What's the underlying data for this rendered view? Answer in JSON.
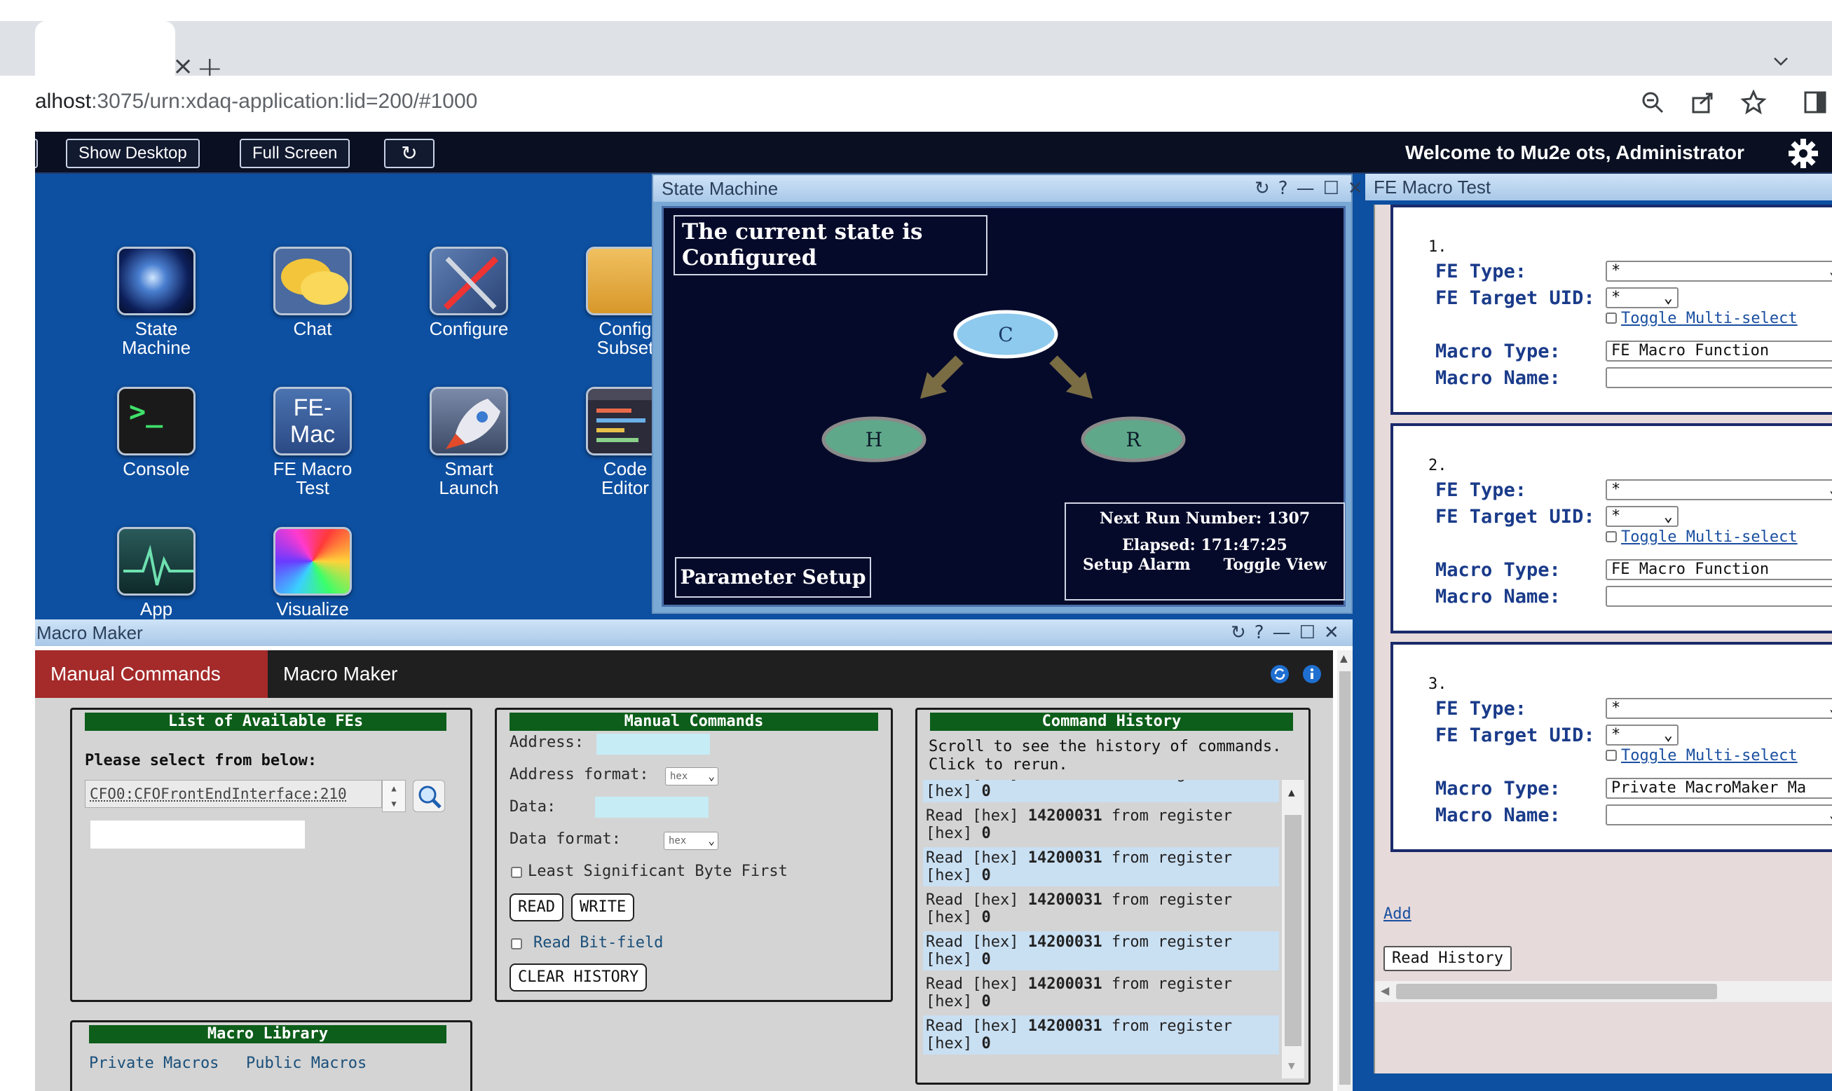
{
  "browser": {
    "tab_close": "×",
    "new_tab": "+",
    "url_host": "alhost",
    "url_rest": ":3075/urn:xdaq-application:lid=200/#1000"
  },
  "topbar": {
    "show_desktop": "Show Desktop",
    "full_screen": "Full Screen",
    "refresh": "↻",
    "welcome": "Welcome to Mu2e ots, Administrator"
  },
  "desktop_icons": [
    {
      "label": "State\nMachine",
      "icon": "galaxy-icon"
    },
    {
      "label": "Chat",
      "icon": "chat-bubbles-icon"
    },
    {
      "label": "Configure",
      "icon": "tools-icon"
    },
    {
      "label": "Config\nSubset",
      "icon": "folder-icon"
    },
    {
      "label": "Console",
      "icon": "terminal-icon",
      "glyph": ">_"
    },
    {
      "label": "FE Macro\nTest",
      "icon": "fe-mac-icon",
      "glyph": "FE-\nMac"
    },
    {
      "label": "Smart\nLaunch",
      "icon": "rocket-icon"
    },
    {
      "label": "Code\nEditor",
      "icon": "code-editor-icon"
    },
    {
      "label": "App",
      "icon": "pulse-icon"
    },
    {
      "label": "Visualize",
      "icon": "prism-icon"
    }
  ],
  "state_machine": {
    "title": "State Machine",
    "current_state": "The current state is Configured",
    "nodes": {
      "center": "C",
      "left": "H",
      "right": "R"
    },
    "parameter_setup": "Parameter Setup",
    "next_run": "Next Run Number: 1307",
    "elapsed": "Elapsed: 171:47:25",
    "setup_alarm": "Setup Alarm",
    "toggle_view": "Toggle View",
    "ctrls": [
      "↻",
      "?",
      "—",
      "☐",
      "✕"
    ]
  },
  "fe_macro_test": {
    "title": "FE Macro Test",
    "labels": {
      "fe_type": "FE Type:",
      "fe_target_uid": "FE Target UID:",
      "toggle_multi": "Toggle Multi-select",
      "macro_type": "Macro Type:",
      "macro_name": "Macro Name:"
    },
    "cards": [
      {
        "num": "1.",
        "fe_type": "*",
        "target_uid": "*",
        "macro_type": "FE Macro Function",
        "macro_name": ""
      },
      {
        "num": "2.",
        "fe_type": "*",
        "target_uid": "*",
        "macro_type": "FE Macro Function",
        "macro_name": ""
      },
      {
        "num": "3.",
        "fe_type": "*",
        "target_uid": "*",
        "macro_type": "Private MacroMaker Ma",
        "macro_name": ""
      }
    ],
    "add": "Add",
    "read_history": "Read History"
  },
  "macro_maker": {
    "title": "Macro Maker",
    "tabs": [
      "Manual Commands",
      "Macro Maker"
    ],
    "fe_list": {
      "heading": "List of Available FEs",
      "prompt": "Please select from below:",
      "selected_fe": "CFO0:CFOFrontEndInterface:210"
    },
    "manual": {
      "heading": "Manual Commands",
      "address": "Address:",
      "address_format": "Address format:",
      "data": "Data:",
      "data_format": "Data format:",
      "format_value": "hex",
      "lsb_first": "Least Significant Byte First",
      "read": "READ",
      "write": "WRITE",
      "read_bitfield": "Read Bit-field",
      "clear_history": "CLEAR HISTORY"
    },
    "history": {
      "heading": "Command History",
      "hint": "Scroll to see the history of commands. Click to rerun.",
      "row_prefix": "Read [hex] ",
      "row_addr": "14200031",
      "row_mid": " from register",
      "row_suffix": "[hex] ",
      "row_val": "0",
      "row_count": 7
    },
    "library": {
      "heading": "Macro Library",
      "private": "Private Macros",
      "public": "Public Macros"
    }
  },
  "colors": {
    "desktop_bg": "#0d4fa0",
    "topbar_bg": "#0a1022",
    "panel_header": "#0d5e1a",
    "active_tab": "#a52a2a",
    "history_highlight": "#c9dff2",
    "node_fill": "#5fa88a",
    "node_current": "#8ec9ee",
    "arrow": "#7a6d44"
  }
}
